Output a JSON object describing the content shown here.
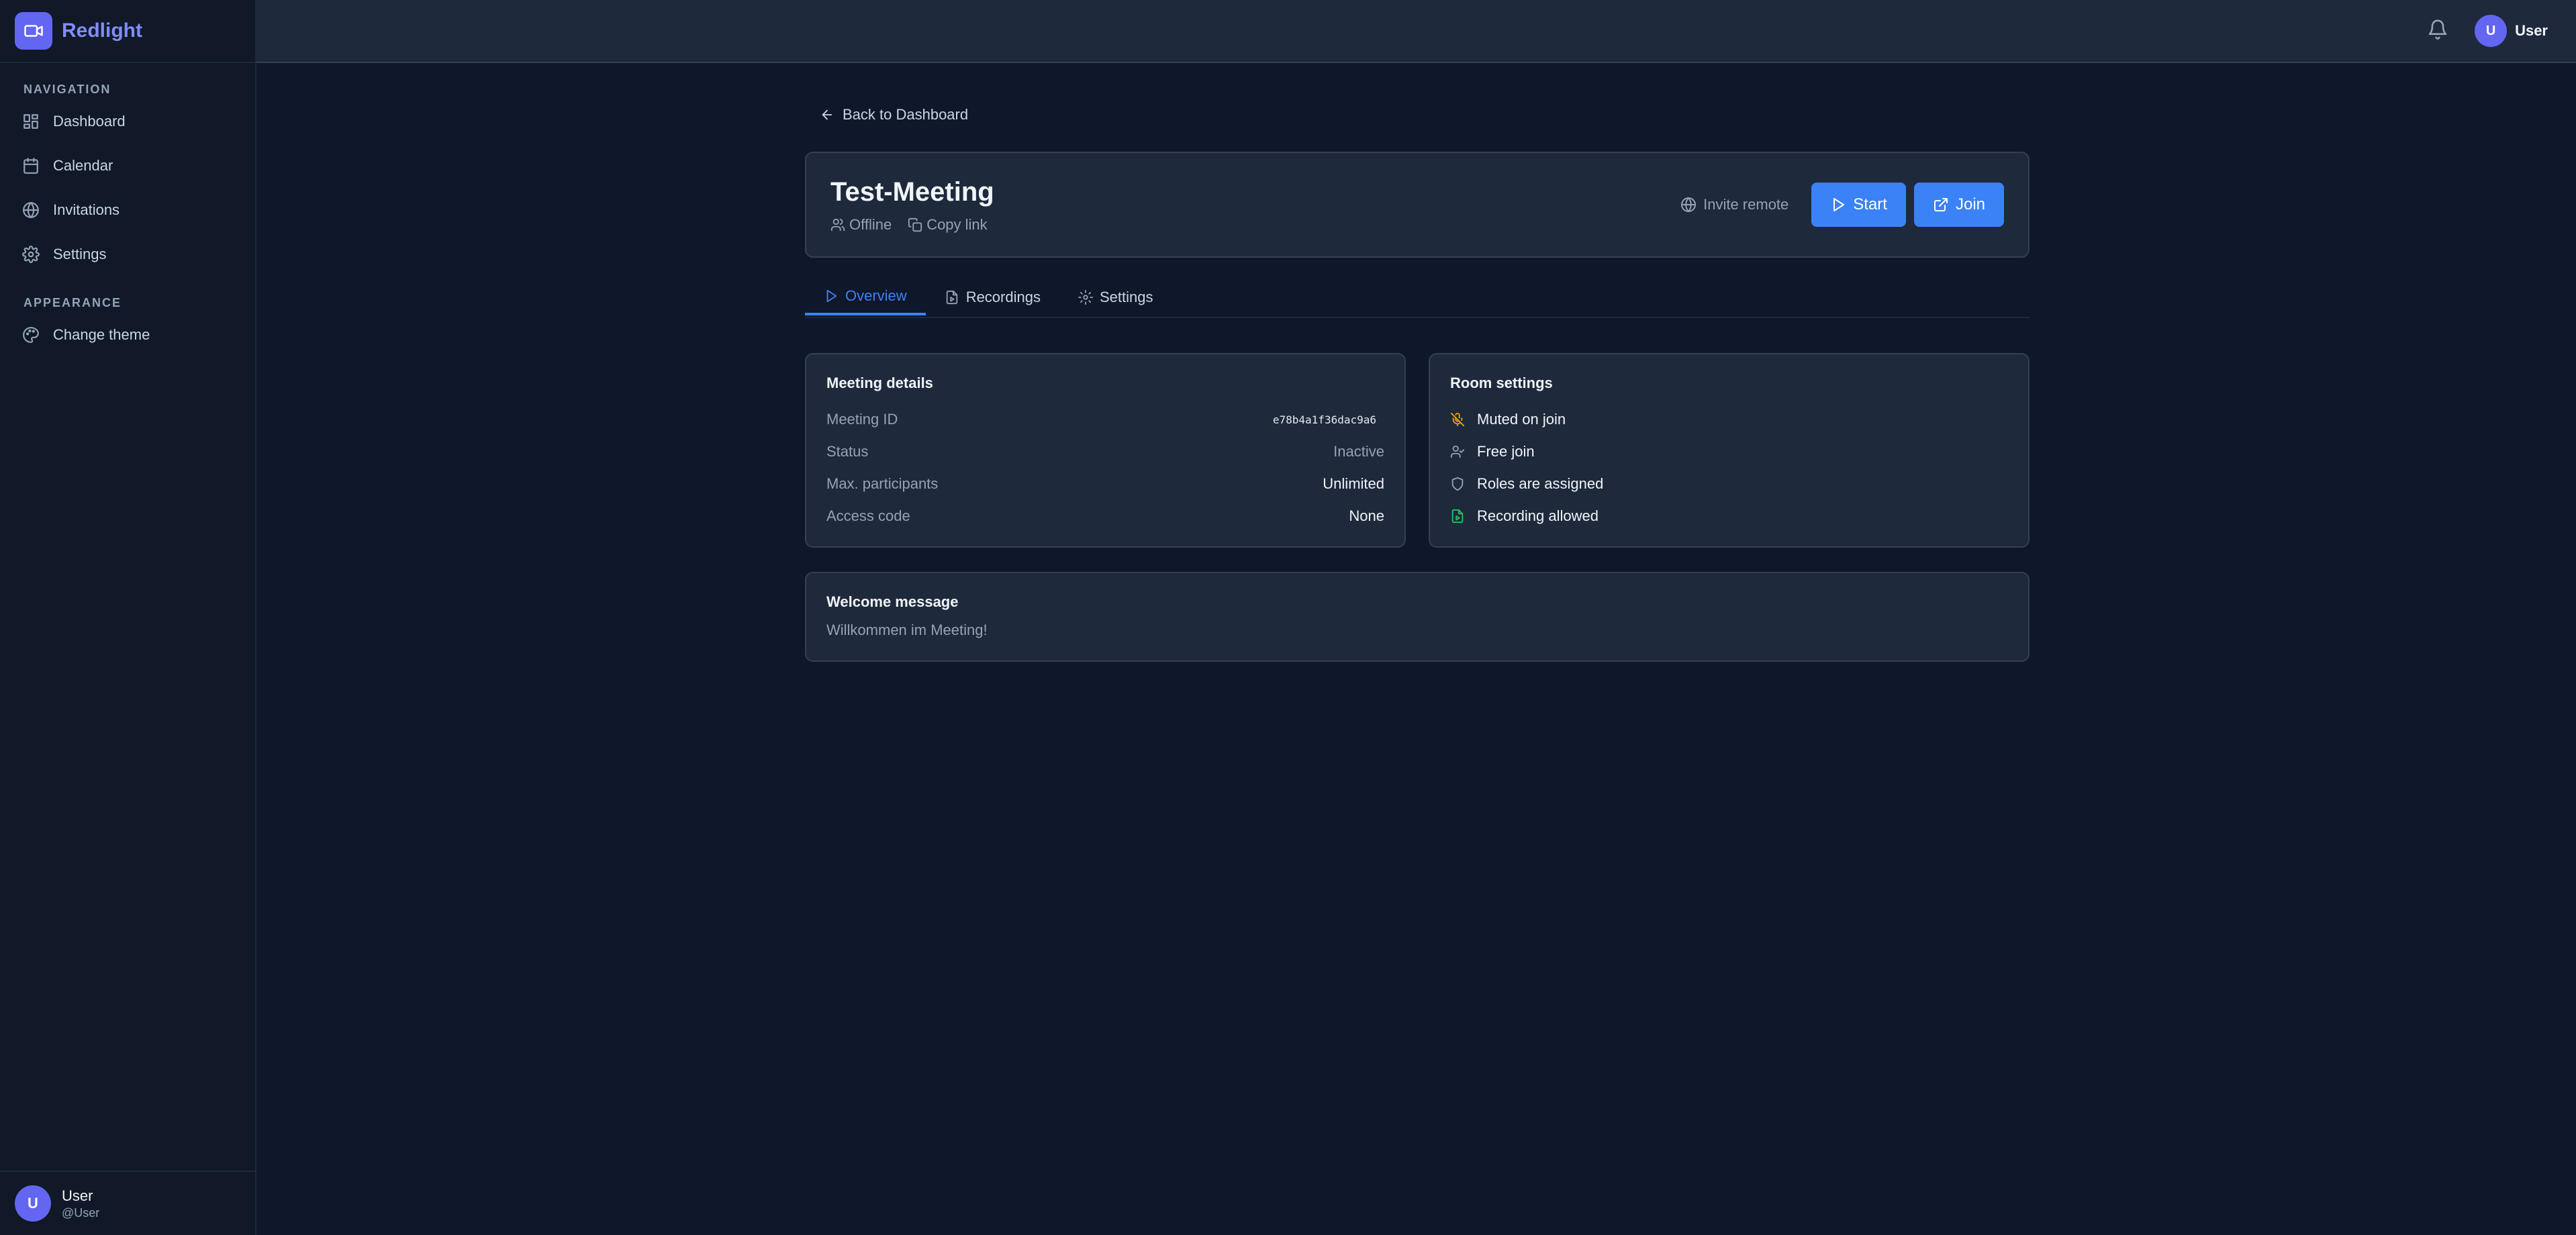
{
  "app": {
    "name": "Redlight"
  },
  "sidebar": {
    "navigation_heading": "NAVIGATION",
    "nav_items": [
      {
        "label": "Dashboard",
        "icon": "grid-icon"
      },
      {
        "label": "Calendar",
        "icon": "calendar-icon"
      },
      {
        "label": "Invitations",
        "icon": "globe-icon"
      },
      {
        "label": "Settings",
        "icon": "gear-icon"
      }
    ],
    "appearance_heading": "APPEARANCE",
    "theme_item": {
      "label": "Change theme",
      "icon": "palette-icon"
    },
    "user": {
      "avatar_letter": "U",
      "name": "User",
      "handle": "@User"
    }
  },
  "topbar": {
    "user": {
      "avatar_letter": "U",
      "name": "User"
    }
  },
  "page": {
    "back_label": "Back to Dashboard",
    "meeting": {
      "title": "Test-Meeting",
      "status_label": "Offline",
      "copy_link_label": "Copy link",
      "invite_remote_label": "Invite remote",
      "start_label": "Start",
      "join_label": "Join"
    },
    "tabs": [
      {
        "label": "Overview",
        "active": true
      },
      {
        "label": "Recordings",
        "active": false
      },
      {
        "label": "Settings",
        "active": false
      }
    ],
    "details": {
      "title": "Meeting details",
      "rows": [
        {
          "label": "Meeting ID",
          "value": "e78b4a1f36dac9a6"
        },
        {
          "label": "Status",
          "value": "Inactive"
        },
        {
          "label": "Max. participants",
          "value": "Unlimited"
        },
        {
          "label": "Access code",
          "value": "None"
        }
      ]
    },
    "room_settings": {
      "title": "Room settings",
      "items": [
        {
          "label": "Muted on join",
          "icon": "mic-off-icon",
          "color": "#f59e0b"
        },
        {
          "label": "Free join",
          "icon": "user-check-icon",
          "color": "#94a3b8"
        },
        {
          "label": "Roles are assigned",
          "icon": "shield-icon",
          "color": "#94a3b8"
        },
        {
          "label": "Recording allowed",
          "icon": "file-video-icon",
          "color": "#22c55e"
        }
      ]
    },
    "welcome": {
      "title": "Welcome message",
      "text": "Willkommen im Meeting!"
    }
  },
  "colors": {
    "accent": "#3b82f6",
    "brand": "#6366f1",
    "background": "#0f172a",
    "card": "#1e293b"
  }
}
